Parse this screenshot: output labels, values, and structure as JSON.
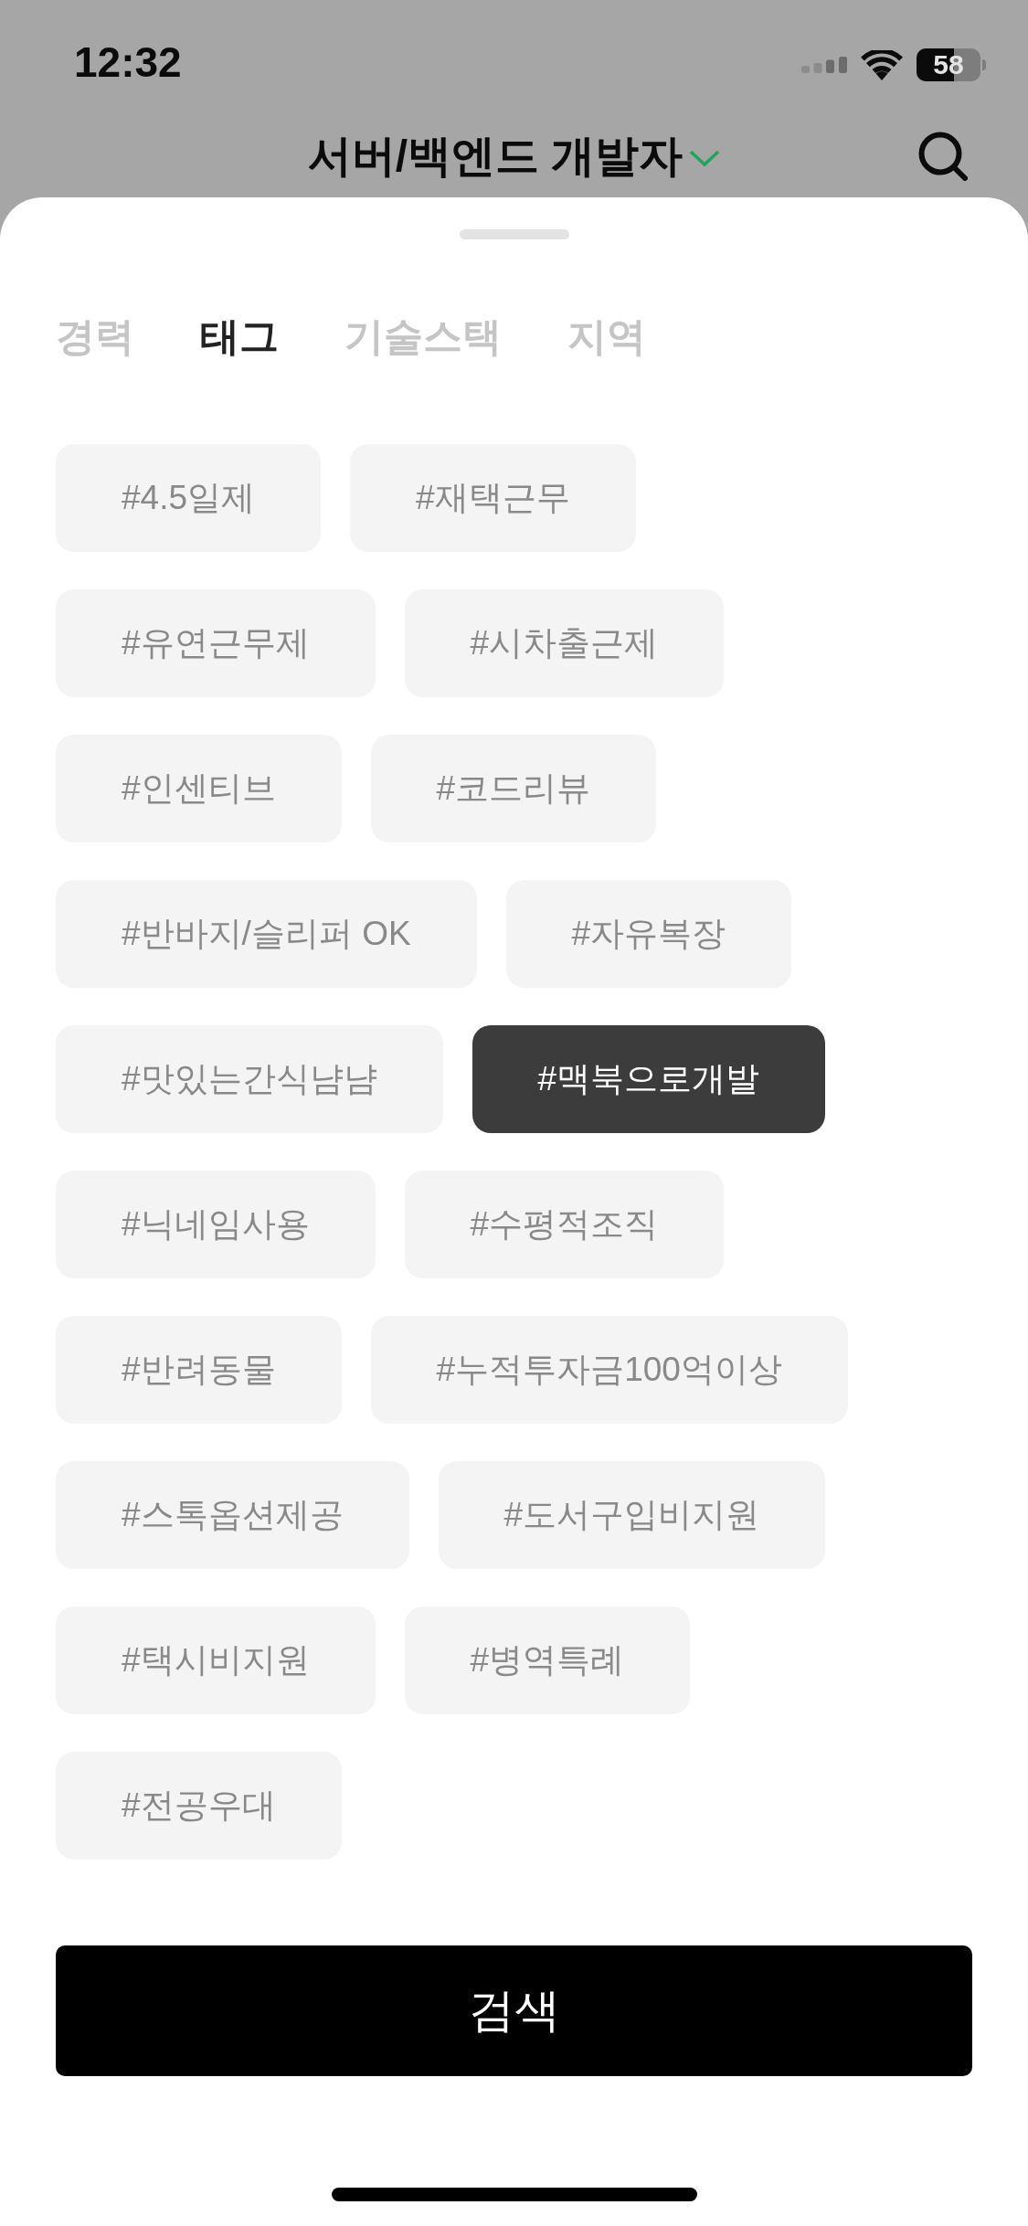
{
  "status_bar": {
    "time": "12:32",
    "battery": "58"
  },
  "header": {
    "title": "서버/백엔드 개발자"
  },
  "sheet": {
    "tabs": [
      {
        "label": "경력",
        "selected": false
      },
      {
        "label": "태그",
        "selected": true
      },
      {
        "label": "기술스택",
        "selected": false
      },
      {
        "label": "지역",
        "selected": false
      }
    ],
    "tags": [
      {
        "label": "#4.5일제",
        "selected": false
      },
      {
        "label": "#재택근무",
        "selected": false
      },
      {
        "label": "#유연근무제",
        "selected": false
      },
      {
        "label": "#시차출근제",
        "selected": false
      },
      {
        "label": "#인센티브",
        "selected": false
      },
      {
        "label": "#코드리뷰",
        "selected": false
      },
      {
        "label": "#반바지/슬리퍼 OK",
        "selected": false
      },
      {
        "label": "#자유복장",
        "selected": false
      },
      {
        "label": "#맛있는간식냠냠",
        "selected": false
      },
      {
        "label": "#맥북으로개발",
        "selected": true
      },
      {
        "label": "#닉네임사용",
        "selected": false
      },
      {
        "label": "#수평적조직",
        "selected": false
      },
      {
        "label": "#반려동물",
        "selected": false
      },
      {
        "label": "#누적투자금100억이상",
        "selected": false
      },
      {
        "label": "#스톡옵션제공",
        "selected": false
      },
      {
        "label": "#도서구입비지원",
        "selected": false
      },
      {
        "label": "#택시비지원",
        "selected": false
      },
      {
        "label": "#병역특례",
        "selected": false
      },
      {
        "label": "#전공우대",
        "selected": false
      }
    ],
    "search_button": {
      "label": "검색"
    }
  }
}
